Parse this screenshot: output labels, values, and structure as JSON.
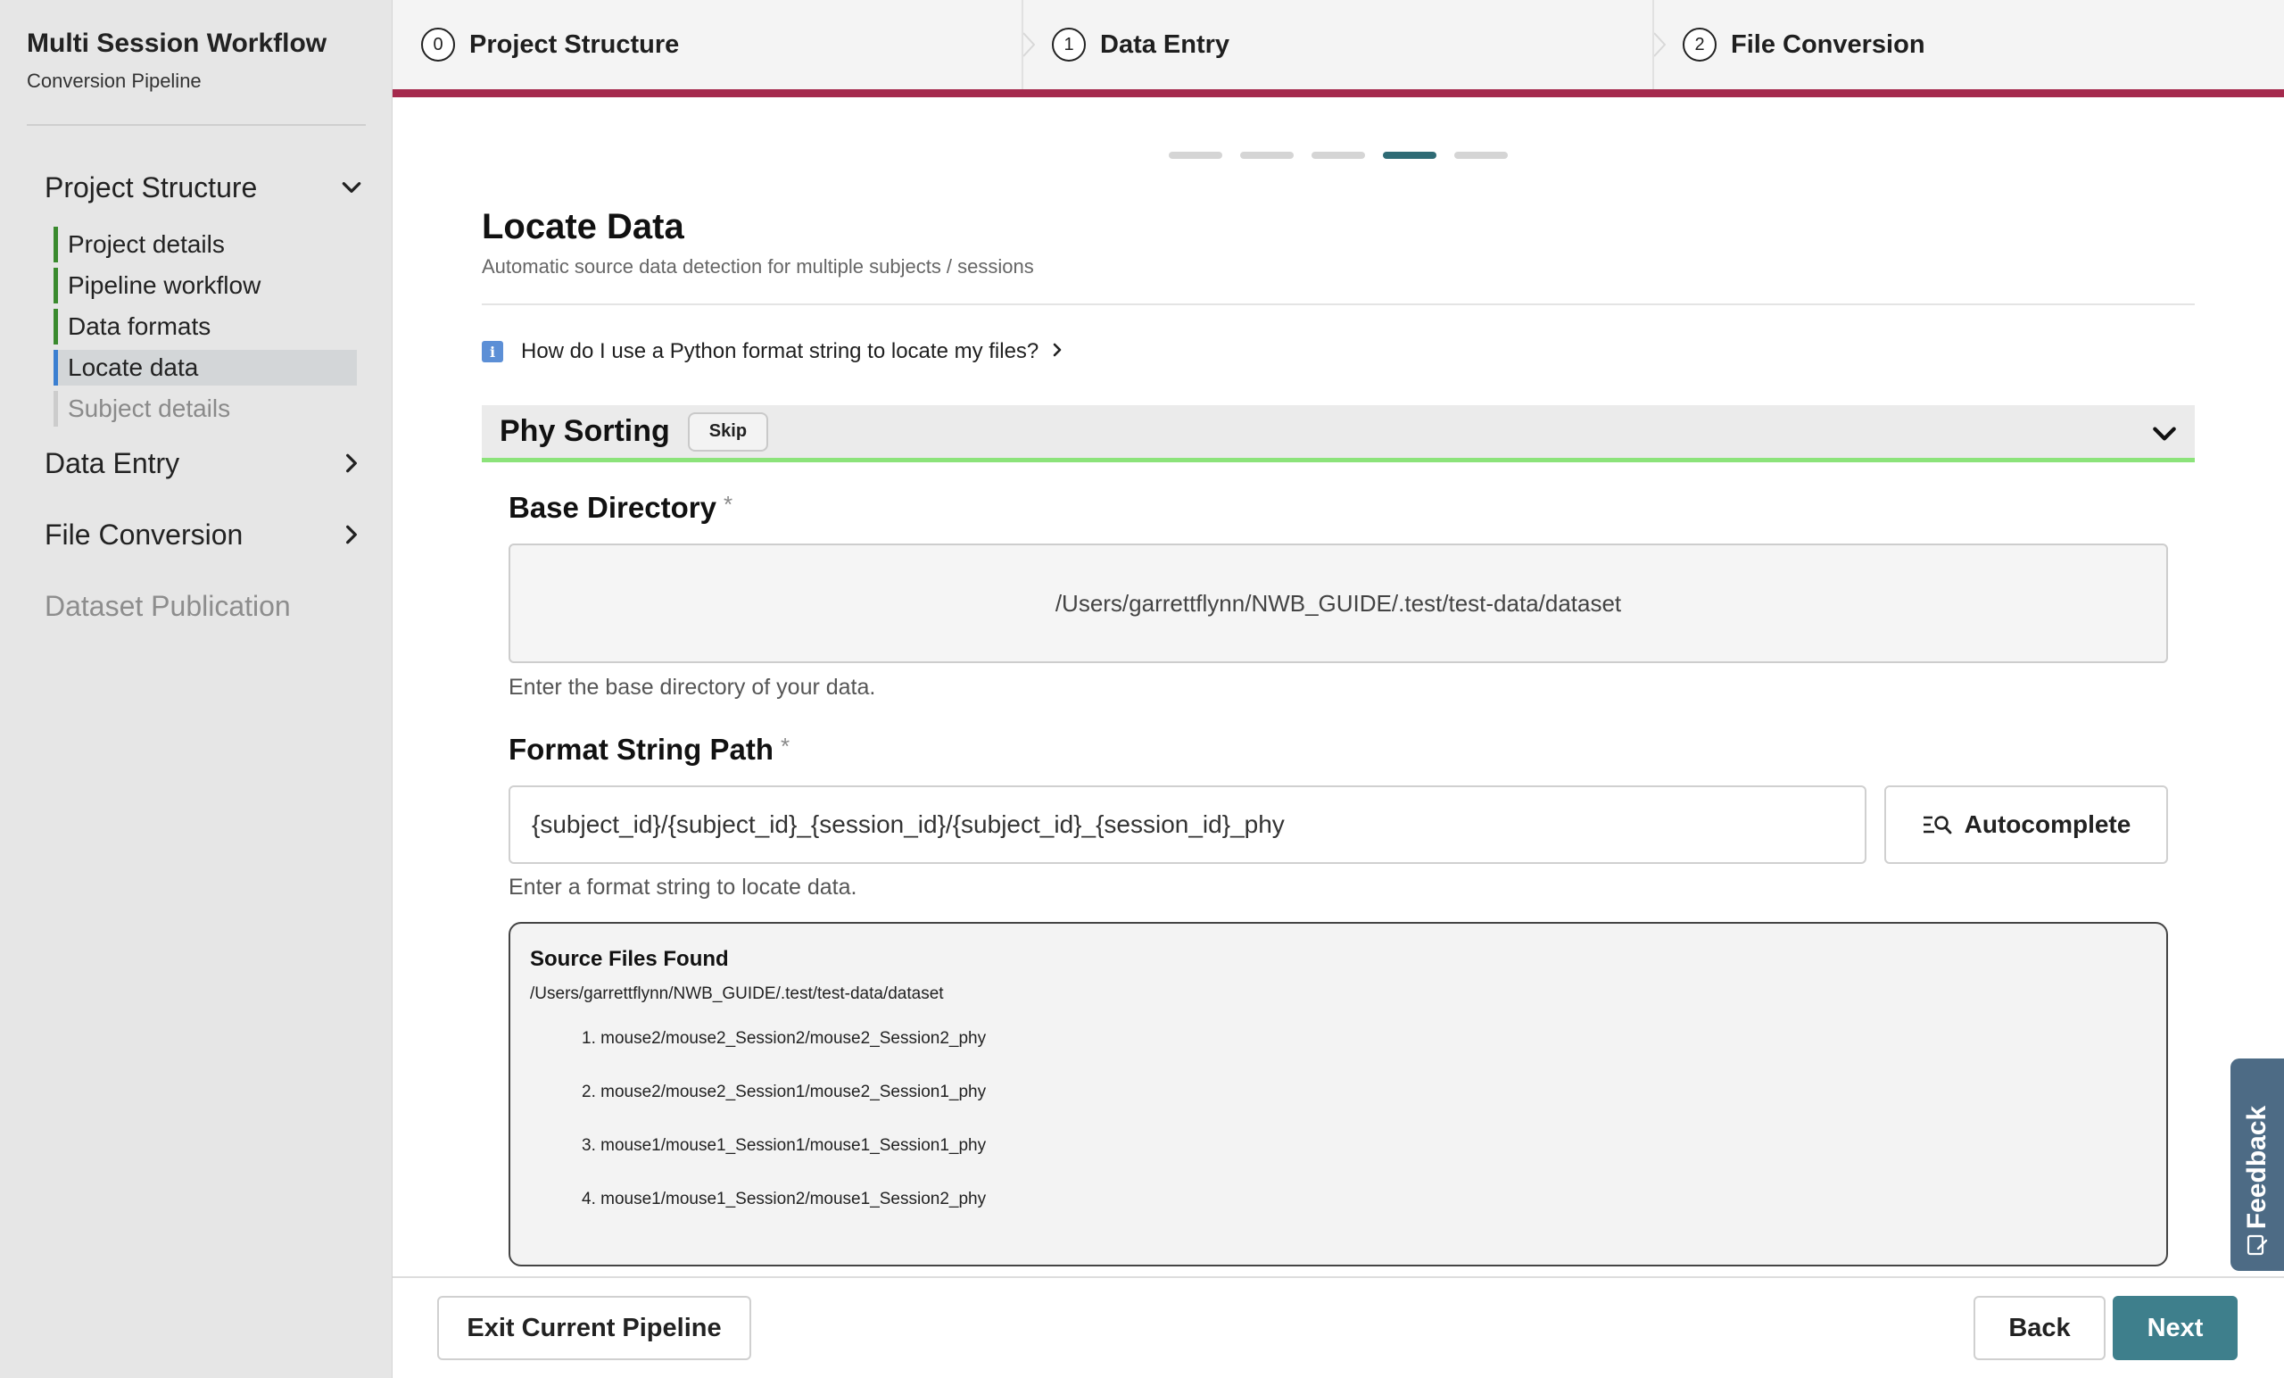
{
  "sidebar": {
    "title": "Multi Session Workflow",
    "subtitle": "Conversion Pipeline",
    "sections": [
      {
        "label": "Project Structure"
      },
      {
        "label": "Data Entry"
      },
      {
        "label": "File Conversion"
      },
      {
        "label": "Dataset Publication"
      }
    ],
    "project_items": [
      {
        "label": "Project details"
      },
      {
        "label": "Pipeline workflow"
      },
      {
        "label": "Data formats"
      },
      {
        "label": "Locate data"
      },
      {
        "label": "Subject details"
      }
    ]
  },
  "stepper": {
    "steps": [
      {
        "num": "0",
        "label": "Project Structure"
      },
      {
        "num": "1",
        "label": "Data Entry"
      },
      {
        "num": "2",
        "label": "File Conversion"
      }
    ],
    "accent_color": "#a52a4d"
  },
  "progress": {
    "total_pages": 5,
    "current_page": 4
  },
  "main": {
    "title": "Locate Data",
    "subtitle": "Automatic source data detection for multiple subjects / sessions",
    "info_icon": "info-icon",
    "info_link": "How do I use a Python format string to locate my files?",
    "accordion": {
      "title": "Phy Sorting",
      "skip_label": "Skip",
      "status_color": "#8ce37a"
    },
    "base_directory": {
      "label": "Base Directory",
      "required_mark": "*",
      "value": "/Users/garrettflynn/NWB_GUIDE/.test/test-data/dataset",
      "help": "Enter the base directory of your data."
    },
    "format_string": {
      "label": "Format String Path",
      "required_mark": "*",
      "value": "{subject_id}/{subject_id}_{session_id}/{subject_id}_{session_id}_phy",
      "help": "Enter a format string to locate data.",
      "autocomplete_label": "Autocomplete"
    },
    "source_files": {
      "title": "Source Files Found",
      "path": "/Users/garrettflynn/NWB_GUIDE/.test/test-data/dataset",
      "files": [
        "1. mouse2/mouse2_Session2/mouse2_Session2_phy",
        "2. mouse2/mouse2_Session1/mouse2_Session1_phy",
        "3. mouse1/mouse1_Session1/mouse1_Session1_phy",
        "4. mouse1/mouse1_Session2/mouse1_Session2_phy"
      ]
    }
  },
  "feedback": {
    "label": "Feedback"
  },
  "footer": {
    "exit_label": "Exit Current Pipeline",
    "back_label": "Back",
    "next_label": "Next",
    "primary_color": "#3e7f8c"
  }
}
